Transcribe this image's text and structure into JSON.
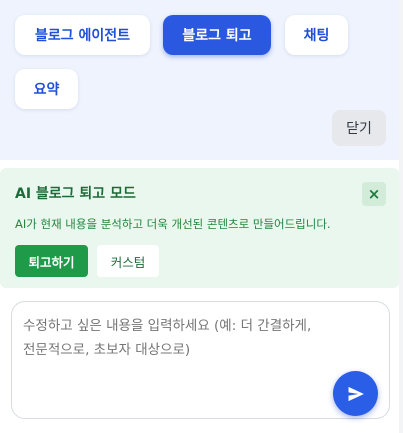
{
  "tabs": [
    {
      "label": "블로그 에이전트",
      "active": false
    },
    {
      "label": "블로그 퇴고",
      "active": true
    },
    {
      "label": "채팅",
      "active": false
    },
    {
      "label": "요약",
      "active": false
    }
  ],
  "close_label": "닫기",
  "mode": {
    "title": "AI 블로그 퇴고 모드",
    "close_icon": "×",
    "description": "AI가 현재 내용을 분석하고 더욱 개선된 콘텐츠로 만들어드립니다.",
    "primary_button": "퇴고하기",
    "secondary_button": "커스텀"
  },
  "input": {
    "placeholder": "수정하고 싶은 내용을 입력하세요 (예: 더 간결하게, 전문적으로, 초보자 대상으로)"
  },
  "colors": {
    "accent": "#2a58e0",
    "panel_bg": "#eef3fd",
    "success": "#1f9a49",
    "success_bg": "#eaf7ee"
  },
  "icons": {
    "send": "send-icon",
    "close": "close-icon"
  }
}
